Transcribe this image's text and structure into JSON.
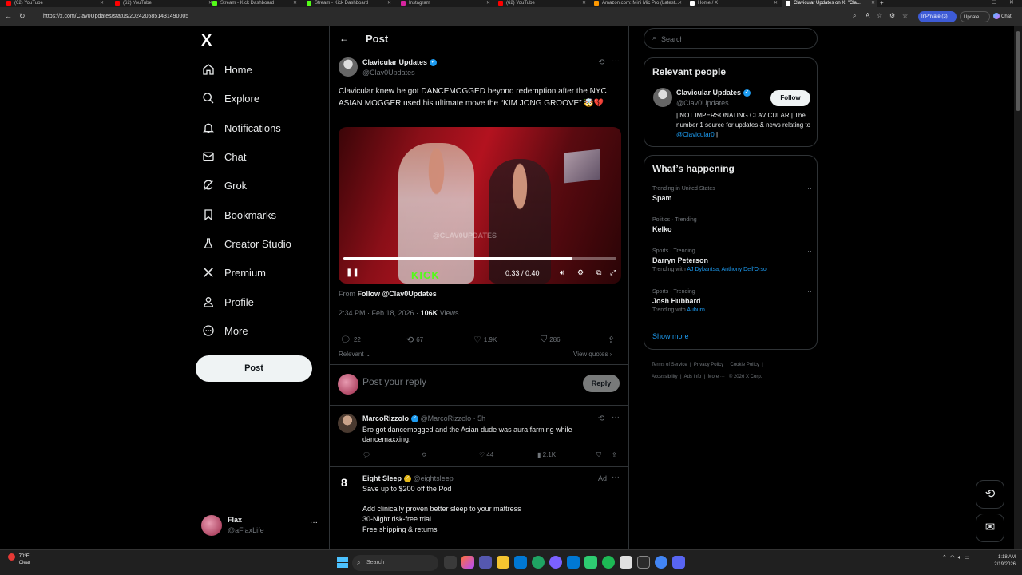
{
  "browser": {
    "tabs": [
      {
        "label": "(62) YouTube",
        "color": "#ff0000"
      },
      {
        "label": "(62) YouTube",
        "color": "#ff0000"
      },
      {
        "label": "Stream - Kick Dashboard",
        "color": "#53fc18"
      },
      {
        "label": "Stream - Kick Dashboard",
        "color": "#53fc18"
      },
      {
        "label": "Instagram",
        "color": "#d6249f"
      },
      {
        "label": "(62) YouTube",
        "color": "#ff0000"
      },
      {
        "label": "Amazon.com: Mini Mic Pro (Latest...",
        "color": "#ff9900"
      },
      {
        "label": "Home / X",
        "color": "#ffffff"
      },
      {
        "label": "Clavicular Updates on X: \"Cla...",
        "color": "#ffffff"
      }
    ],
    "url": "https://x.com/Clav0Updates/status/2024205851431490005",
    "inprivate_label": "InPrivate (3)",
    "update_label": "Update",
    "chat_label": "Chat"
  },
  "nav": {
    "logo": "X",
    "items": [
      {
        "label": "Home",
        "icon": "home-icon"
      },
      {
        "label": "Explore",
        "icon": "search-icon"
      },
      {
        "label": "Notifications",
        "icon": "bell-icon"
      },
      {
        "label": "Chat",
        "icon": "mail-icon"
      },
      {
        "label": "Grok",
        "icon": "grok-icon"
      },
      {
        "label": "Bookmarks",
        "icon": "bookmark-icon"
      },
      {
        "label": "Creator Studio",
        "icon": "flask-icon"
      },
      {
        "label": "Premium",
        "icon": "x-icon"
      },
      {
        "label": "Profile",
        "icon": "person-icon"
      },
      {
        "label": "More",
        "icon": "more-circle-icon"
      }
    ],
    "post_button": "Post",
    "account": {
      "name": "Flax",
      "handle": "@aFlaxLife",
      "more": "···"
    }
  },
  "header": {
    "back": "←",
    "title": "Post"
  },
  "tweet": {
    "name": "Clavicular Updates",
    "handle": "@Clav0Updates",
    "text": "Clavicular knew he got DANCEMOGGED beyond redemption after the NYC ASIAN MOGGER used his ultimate move the “KIM JONG GROOVE” 🤯💔",
    "video": {
      "watermark": "@CLAV0UPDATES",
      "kick_logo": "KICK",
      "time": "0:33 / 0:40",
      "progress": 0.84
    },
    "from_prefix": "From",
    "from_link": "Follow @Clav0Updates",
    "timestamp": "2:34 PM · Feb 18, 2026 ·",
    "views_count": "106K",
    "views_label": "Views",
    "stats": {
      "replies": "22",
      "reposts": "67",
      "likes": "1.9K",
      "bookmarks": "286"
    },
    "relevant": "Relevant",
    "view_quotes": "View quotes"
  },
  "reply_box": {
    "placeholder": "Post your reply",
    "button": "Reply"
  },
  "comment": {
    "name": "MarcoRizzolo",
    "handle": "@MarcoRizzolo · 5h",
    "text": "Bro got dancemogged and the Asian dude was aura farming while dancemaxxing.",
    "stats": {
      "likes": "44",
      "views": "2.1K"
    }
  },
  "ad": {
    "logo": "8",
    "name": "Eight Sleep",
    "handle": "@eightsleep",
    "tag": "Ad",
    "lines": [
      "Save up to $200 off the Pod",
      "Add clinically proven better sleep to your mattress",
      "30-Night risk-free trial",
      "Free shipping & returns"
    ]
  },
  "sidebar": {
    "search_placeholder": "Search",
    "relevant_people": {
      "title": "Relevant people",
      "name": "Clavicular Updates",
      "handle": "@Clav0Updates",
      "follow": "Follow",
      "bio": "| NOT IMPERSONATING CLAVICULAR | The number 1 source for updates & news relating to",
      "bio_link": "@Clavicular0",
      "bio_end": "|"
    },
    "happening": {
      "title": "What’s happening",
      "trends": [
        {
          "category": "Trending in United States",
          "title": "Spam",
          "with": ""
        },
        {
          "category": "Politics · Trending",
          "title": "Kelko",
          "with": ""
        },
        {
          "category": "Sports · Trending",
          "title": "Darryn Peterson",
          "with_prefix": "Trending with",
          "with": "AJ Dybantsa, Anthony Dell'Orso"
        },
        {
          "category": "Sports · Trending",
          "title": "Josh Hubbard",
          "with_prefix": "Trending with",
          "with": "Auburn"
        }
      ],
      "show_more": "Show more"
    },
    "footer": {
      "links": [
        "Terms of Service",
        "Privacy Policy",
        "Cookie Policy",
        "Accessibility",
        "Ads info",
        "More ···"
      ],
      "copyright": "© 2026 X Corp."
    }
  },
  "taskbar": {
    "temp": "70°F",
    "condition": "Clear",
    "search": "Search",
    "time": "1:18 AM",
    "date": "2/19/2026"
  }
}
